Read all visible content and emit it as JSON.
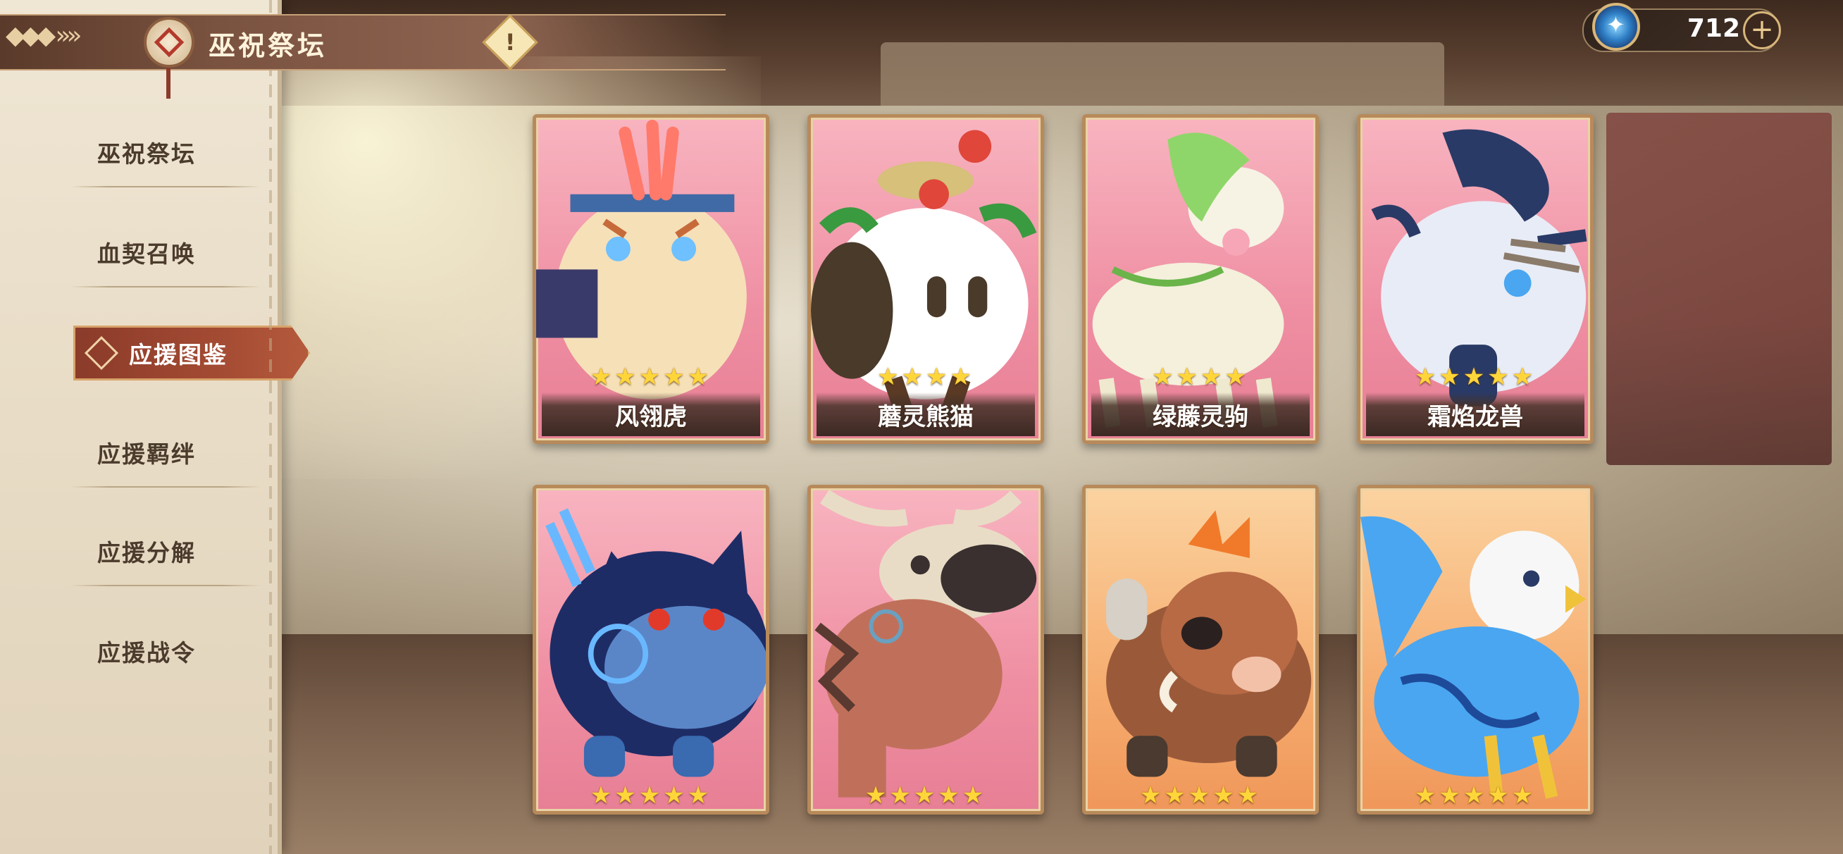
{
  "header": {
    "title": "巫祝祭坛",
    "info_symbol": "!"
  },
  "currency": {
    "icon": "star-gem-icon",
    "value": "712",
    "plus_symbol": "+"
  },
  "sidebar": {
    "items": [
      {
        "label": "巫祝祭坛",
        "active": false
      },
      {
        "label": "血契召唤",
        "active": false
      },
      {
        "label": "应援图鉴",
        "active": true
      },
      {
        "label": "应援羁绊",
        "active": false
      },
      {
        "label": "应援分解",
        "active": false
      },
      {
        "label": "应援战令",
        "active": false
      }
    ]
  },
  "cards": [
    {
      "name": "风翎虎",
      "stars": 5,
      "rarity": "pink",
      "creature": "tiger"
    },
    {
      "name": "蘑灵熊猫",
      "stars": 4,
      "rarity": "pink",
      "creature": "panda"
    },
    {
      "name": "绿藤灵驹",
      "stars": 4,
      "rarity": "pink",
      "creature": "deer"
    },
    {
      "name": "霜焰龙兽",
      "stars": 5,
      "rarity": "pink",
      "creature": "dragon"
    },
    {
      "name": "",
      "stars": 5,
      "rarity": "pink",
      "creature": "cat"
    },
    {
      "name": "",
      "stars": 5,
      "rarity": "pink",
      "creature": "dino"
    },
    {
      "name": "",
      "stars": 5,
      "rarity": "orange",
      "creature": "boar"
    },
    {
      "name": "",
      "stars": 5,
      "rarity": "orange",
      "creature": "griffin"
    }
  ],
  "colors": {
    "accent_red": "#a34a33",
    "card_pink": "#ef8ea2",
    "card_orange": "#f6ad70",
    "star": "#ffd63a"
  }
}
